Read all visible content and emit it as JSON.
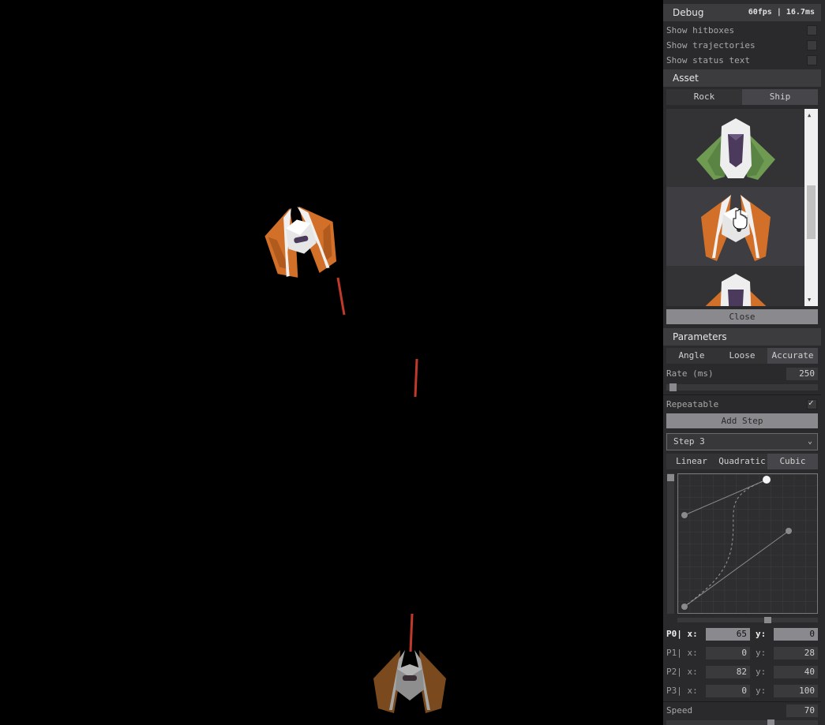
{
  "debug": {
    "title": "Debug",
    "fps": "60fps | 16.7ms",
    "options": [
      {
        "label": "Show hitboxes",
        "checked": false
      },
      {
        "label": "Show trajectories",
        "checked": false
      },
      {
        "label": "Show status text",
        "checked": false
      }
    ]
  },
  "asset": {
    "title": "Asset",
    "tabs": [
      {
        "label": "Rock",
        "active": false
      },
      {
        "label": "Ship",
        "active": true
      }
    ],
    "items": [
      {
        "icon": "green-ship-icon",
        "selected": false
      },
      {
        "icon": "orange-ship-icon",
        "selected": true
      },
      {
        "icon": "orange-ship-icon",
        "selected": false
      }
    ],
    "close_label": "Close"
  },
  "parameters": {
    "title": "Parameters",
    "mode_tabs": [
      {
        "label": "Angle",
        "active": false
      },
      {
        "label": "Loose",
        "active": false
      },
      {
        "label": "Accurate",
        "active": true
      }
    ],
    "rate_label": "Rate (ms)",
    "rate_value": "250",
    "rate_slider_fraction": 0.02,
    "repeatable_label": "Repeatable",
    "repeatable": true,
    "add_step_label": "Add Step",
    "step_selected": "Step 3",
    "curve_tabs": [
      {
        "label": "Linear",
        "active": false
      },
      {
        "label": "Quadratic",
        "active": false
      },
      {
        "label": "Cubic",
        "active": true
      }
    ],
    "curve_scrub_fraction": 0.65,
    "points": [
      {
        "label": "P0| x:",
        "x": "65",
        "y_label": "y:",
        "y": "0",
        "current": true
      },
      {
        "label": "P1| x:",
        "x": "0",
        "y_label": "y:",
        "y": "28",
        "current": false
      },
      {
        "label": "P2| x:",
        "x": "82",
        "y_label": "y:",
        "y": "40",
        "current": false
      },
      {
        "label": "P3| x:",
        "x": "0",
        "y_label": "y:",
        "y": "100",
        "current": false
      }
    ],
    "speed_label": "Speed",
    "speed_value": "70",
    "speed_slider_fraction": 0.7
  },
  "colors": {
    "ship_orange": "#d2702a",
    "ship_green": "#6e9a52",
    "laser": "#c0392b",
    "player_brown": "#7a4a1e"
  }
}
